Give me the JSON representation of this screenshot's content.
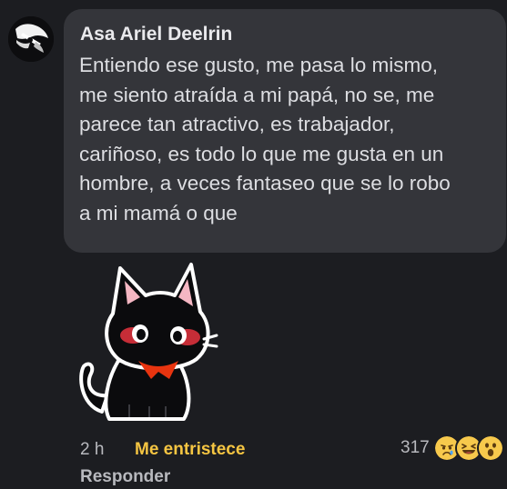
{
  "comment": {
    "author": "Asa Ariel Deelrin",
    "lines": [
      "Entiendo ese gusto, me pasa lo mismo,",
      "me siento atraída a mi papá, no se, me",
      "parece tan atractivo, es trabajador,",
      "cariñoso, es todo lo que me gusta en un",
      "hombre, a veces fantaseo que se lo robo",
      "a mi mamá o que"
    ],
    "time": "2 h",
    "user_reaction": "Me entristece",
    "reply_label": "Responder",
    "reaction_count": "317",
    "reaction_icons": [
      "sad-reaction-icon",
      "haha-reaction-icon",
      "wow-reaction-icon"
    ],
    "sticker": "black-cat-sticker"
  },
  "colors": {
    "background": "#1c1d21",
    "bubble": "#34353a",
    "reaction_accent": "#f5c542",
    "secondary_text": "#b8b9be"
  }
}
